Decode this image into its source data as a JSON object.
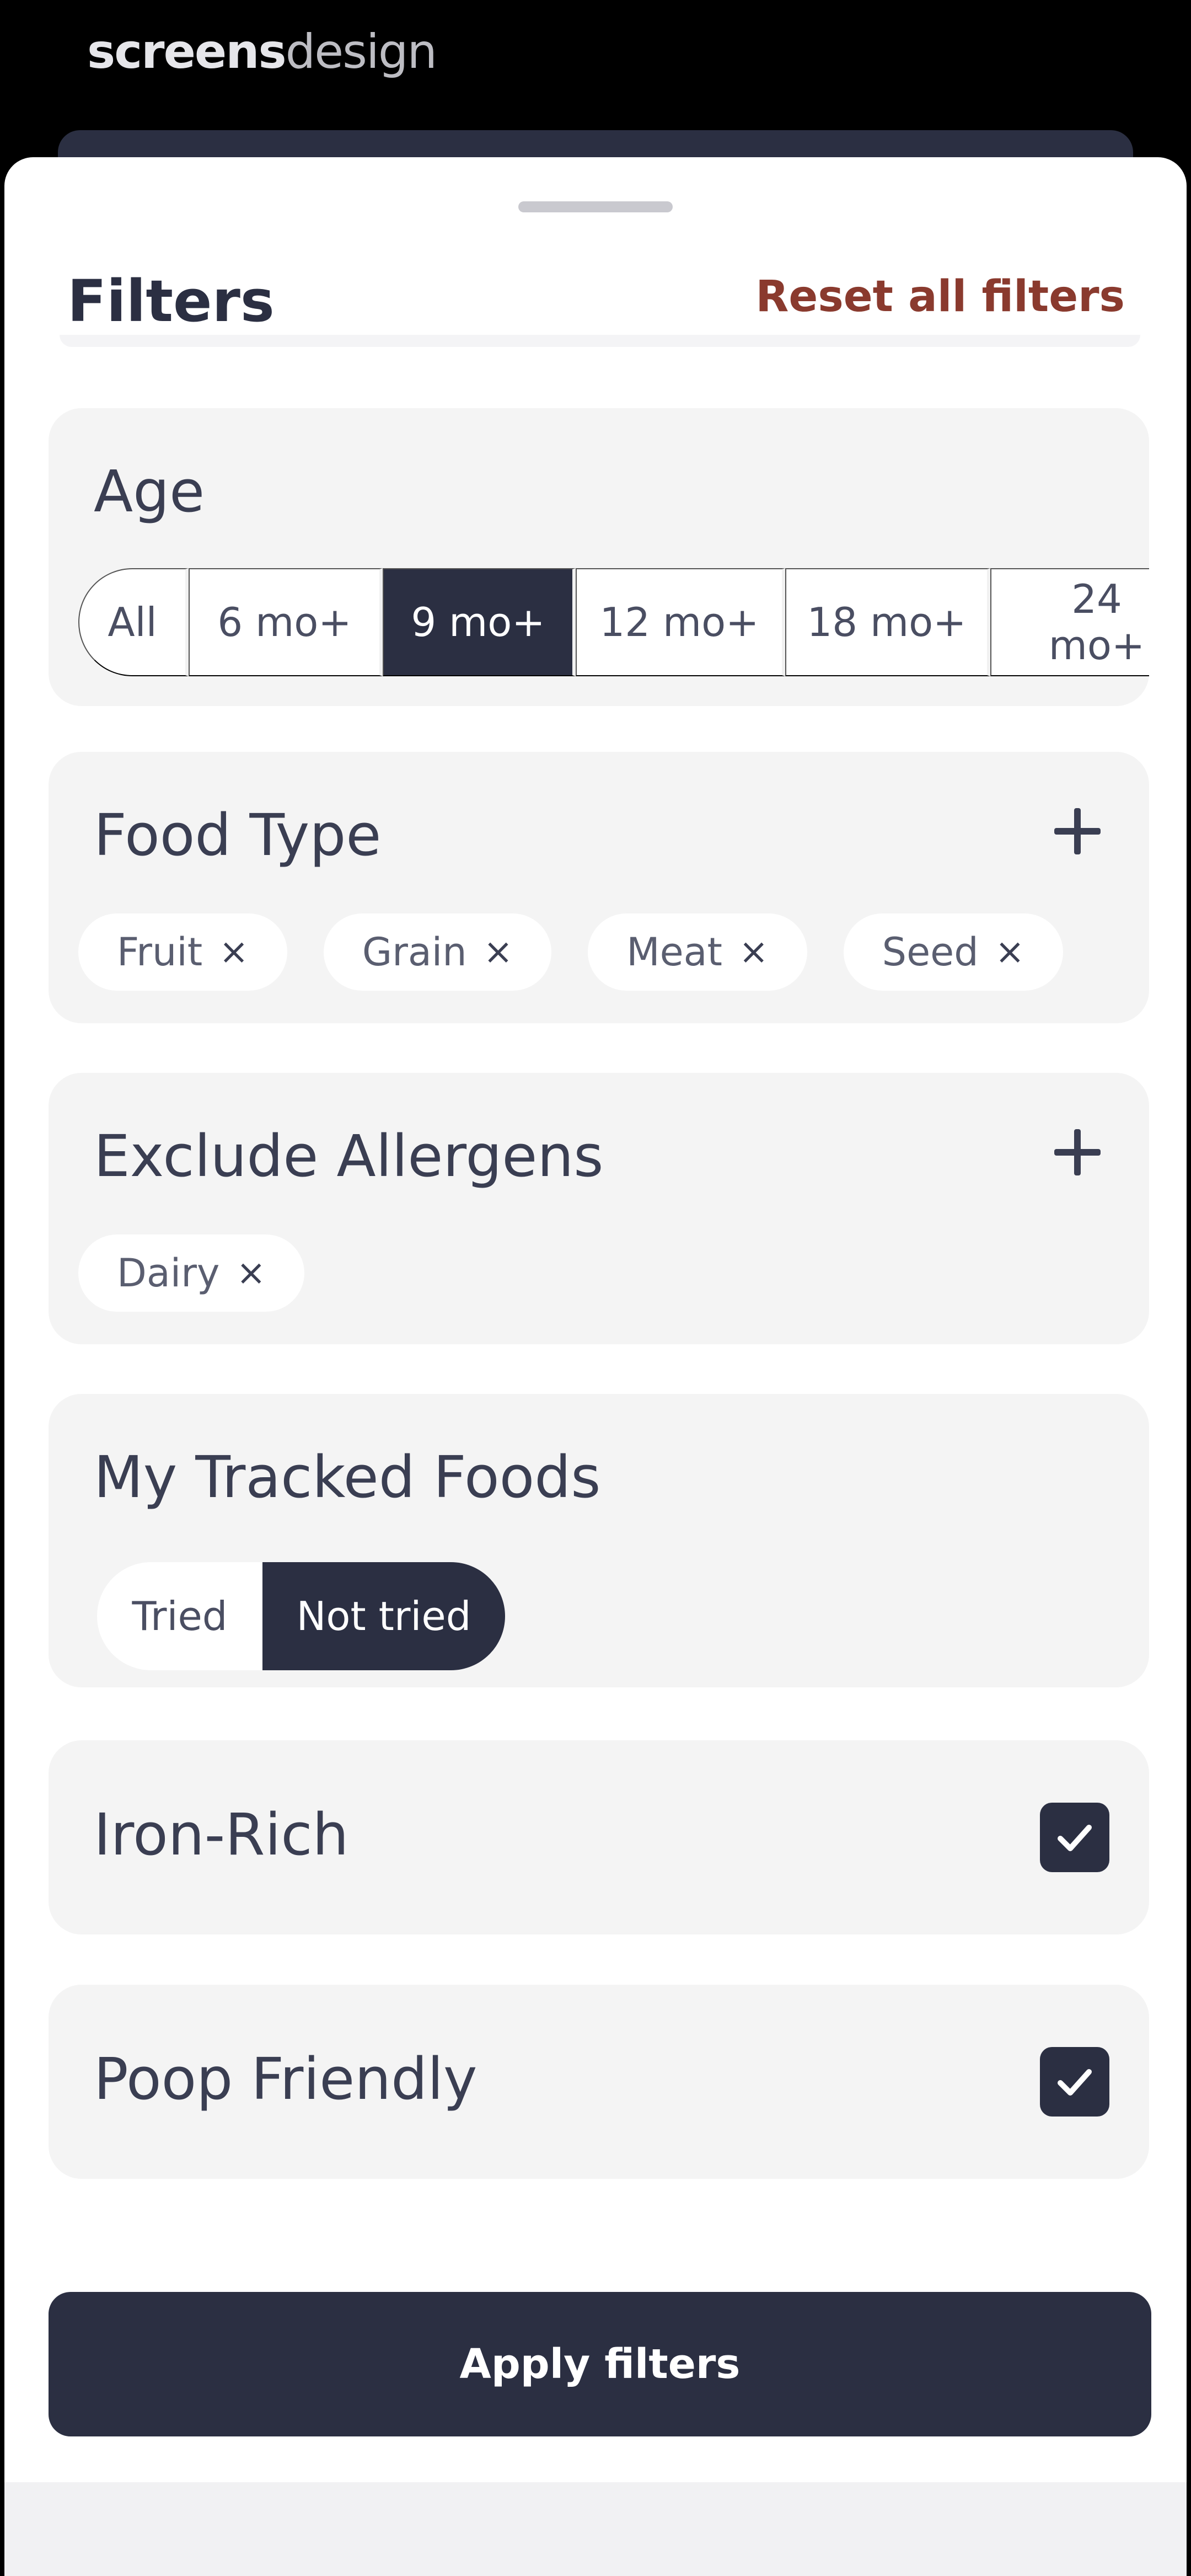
{
  "brand": {
    "part1": "screens",
    "part2": "design"
  },
  "sheet": {
    "title": "Filters",
    "reset_label": "Reset all filters"
  },
  "age": {
    "title": "Age",
    "options": [
      "All",
      "6 mo+",
      "9 mo+",
      "12 mo+",
      "18 mo+",
      "24 mo+"
    ],
    "selected": "9 mo+"
  },
  "food_type": {
    "title": "Food Type",
    "chips": [
      "Fruit",
      "Grain",
      "Meat",
      "Seed"
    ]
  },
  "allergens": {
    "title": "Exclude Allergens",
    "chips": [
      "Dairy"
    ]
  },
  "tracked": {
    "title": "My Tracked Foods",
    "options": [
      "Tried",
      "Not tried"
    ],
    "selected": "Not tried"
  },
  "iron_rich": {
    "title": "Iron-Rich",
    "checked": true
  },
  "poop_friendly": {
    "title": "Poop Friendly",
    "checked": true
  },
  "apply_label": "Apply filters",
  "icons": {
    "remove": "×",
    "add": "plus-icon",
    "check": "check-icon"
  },
  "colors": {
    "accent": "#2b2f42",
    "reset": "#8a3a2e",
    "card": "#f4f4f4"
  }
}
